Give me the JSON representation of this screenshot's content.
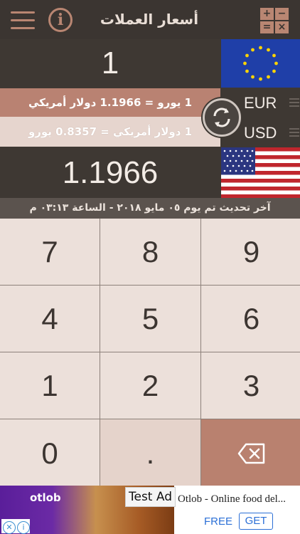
{
  "header": {
    "title": "أسعار العملات",
    "menu_icon": "hamburger-icon",
    "info_icon": "info-icon",
    "info_glyph": "i",
    "calculator_icon": "calculator-icon",
    "calc_symbols": [
      "+",
      "−",
      "=",
      "×"
    ]
  },
  "converter": {
    "amount": "1",
    "result": "1.1966",
    "rate_from": "1 يورو = 1.1966 دولار أمريكي",
    "rate_to": "1 دولار أمريكي = 0.8357 يورو",
    "from_currency": "EUR",
    "to_currency": "USD",
    "from_flag_icon": "eu-flag-icon",
    "to_flag_icon": "us-flag-icon",
    "swap_icon": "swap-arrows-icon",
    "updated": "آخر تحديث تم يوم ٠٥ مايو ٢٠١٨ - الساعة ٠٣:١٣ م"
  },
  "keypad": {
    "keys": [
      "7",
      "8",
      "9",
      "4",
      "5",
      "6",
      "1",
      "2",
      "3",
      "0",
      "."
    ],
    "backspace_icon": "backspace-icon"
  },
  "ad": {
    "badge": "Test Ad",
    "brand": "otlob",
    "headline": "Otlob - Online food del...",
    "price": "FREE",
    "cta": "GET"
  },
  "colors": {
    "accent": "#b98672",
    "dark_bg": "#3e3833",
    "key_bg": "#ece0da",
    "link_blue": "#2b6fd6"
  }
}
